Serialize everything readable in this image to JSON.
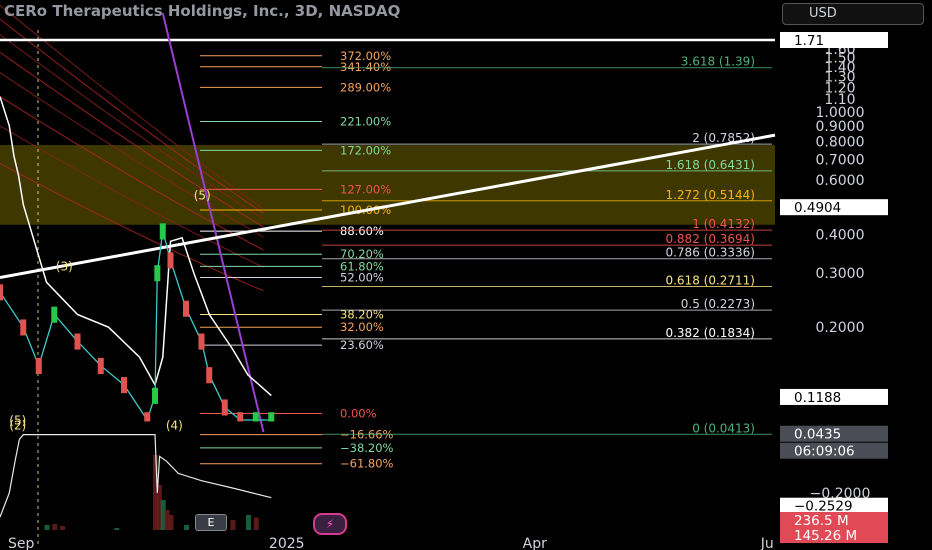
{
  "header": {
    "title": "CERo Therapeutics Holdings, Inc., 3D, NASDAQ",
    "currency": "USD",
    "earnings_badge": "E",
    "flash_icon": "lightning-icon"
  },
  "chart_data": {
    "type": "line",
    "ticker_title": "CERo Therapeutics Holdings, Inc., 3D, NASDAQ",
    "y_scale": "log",
    "ylim": [
      0.0105,
      2.09
    ],
    "y_ticks": [
      {
        "v": 1.6,
        "t": "1.60"
      },
      {
        "v": 1.5,
        "t": "1.50"
      },
      {
        "v": 1.4,
        "t": "1.40"
      },
      {
        "v": 1.3,
        "t": "1.30"
      },
      {
        "v": 1.2,
        "t": "1.20"
      },
      {
        "v": 1.1,
        "t": "1.10"
      },
      {
        "v": 1.0,
        "t": "1.0000"
      },
      {
        "v": 0.9,
        "t": "0.9000"
      },
      {
        "v": 0.8,
        "t": "0.8000"
      },
      {
        "v": 0.7,
        "t": "0.7000"
      },
      {
        "v": 0.6,
        "t": "0.6000"
      },
      {
        "v": 0.4,
        "t": "0.4000"
      },
      {
        "v": 0.3,
        "t": "0.3000"
      },
      {
        "v": 0.2,
        "t": "0.2000"
      },
      {
        "v": -0.2,
        "t": "−0.2000"
      }
    ],
    "price_markers": [
      {
        "v": 1.71,
        "t": "1.71",
        "style": "white"
      },
      {
        "v": 0.4904,
        "t": "0.4904",
        "style": "white"
      },
      {
        "v": 0.1188,
        "t": "0.1188",
        "style": "white"
      },
      {
        "v": 0.0435,
        "t": "0.0435",
        "style": "gray"
      },
      {
        "countdown": "06:09:06",
        "style": "gray"
      },
      {
        "v": -0.2529,
        "t": "−0.2529",
        "style": "white"
      },
      {
        "t": "236.5 M",
        "style": "red"
      },
      {
        "t": "145.26 M",
        "style": "red"
      }
    ],
    "x_labels": [
      {
        "t": "Sep",
        "pos": 0.0
      },
      {
        "t": "2025",
        "pos": 0.37
      },
      {
        "t": "Apr",
        "pos": 0.69
      },
      {
        "t": "Ju",
        "pos": 0.99
      }
    ],
    "fib_extension_levels": [
      {
        "label": "372.00%",
        "v": 1.52,
        "color": "#f7a35c"
      },
      {
        "label": "341.40%",
        "v": 1.4,
        "color": "#f7a35c"
      },
      {
        "label": "289.00%",
        "v": 1.2,
        "color": "#f7a35c"
      },
      {
        "label": "221.00%",
        "v": 0.93,
        "color": "#7fd9a1"
      },
      {
        "label": "172.00%",
        "v": 0.75,
        "color": "#7fd9a1"
      },
      {
        "label": "127.00%",
        "v": 0.56,
        "color": "#f0544f"
      },
      {
        "label": "100.00%",
        "v": 0.48,
        "color": "#f7b500"
      },
      {
        "label": "88.60%",
        "v": 0.41,
        "color": "#ffffff"
      },
      {
        "label": "70.20%",
        "v": 0.345,
        "color": "#7fd9a1"
      },
      {
        "label": "61.80%",
        "v": 0.315,
        "color": "#7fd9a1"
      },
      {
        "label": "52.00%",
        "v": 0.29,
        "color": "#d1d4dc"
      },
      {
        "label": "38.20%",
        "v": 0.22,
        "color": "#f7e27f"
      },
      {
        "label": "32.00%",
        "v": 0.2,
        "color": "#f7a35c"
      },
      {
        "label": "23.60%",
        "v": 0.175,
        "color": "#d1d4dc"
      },
      {
        "label": "0.00%",
        "v": 0.105,
        "color": "#f0544f"
      },
      {
        "label": "−16.66%",
        "v": 0.04,
        "color": "#f7a35c"
      },
      {
        "label": "−38.20%",
        "v": -0.015,
        "color": "#7fd9a1"
      },
      {
        "label": "−61.80%",
        "v": -0.08,
        "color": "#f7a35c"
      }
    ],
    "fib_retracement_levels": [
      {
        "label": "3.618 (1.39)",
        "v": 1.39,
        "color": "#4fb07c"
      },
      {
        "label": "2 (0.7852)",
        "v": 0.7852,
        "color": "#d1d4dc"
      },
      {
        "label": "1.618 (0.6431)",
        "v": 0.6431,
        "color": "#7fd9a1"
      },
      {
        "label": "1.272 (0.5144)",
        "v": 0.5144,
        "color": "#f7b500"
      },
      {
        "label": "1 (0.4132)",
        "v": 0.4132,
        "color": "#f0544f"
      },
      {
        "label": "0.882 (0.3694)",
        "v": 0.3694,
        "color": "#f0544f"
      },
      {
        "label": "0.786 (0.3336)",
        "v": 0.3336,
        "color": "#d1d4dc"
      },
      {
        "label": "0.618 (0.2711)",
        "v": 0.2711,
        "color": "#f7e27f"
      },
      {
        "label": "0.5 (0.2273)",
        "v": 0.2273,
        "color": "#d1d4dc"
      },
      {
        "label": "0.382 (0.1834)",
        "v": 0.1834,
        "color": "#ffffff"
      },
      {
        "label": "0 (0.0413)",
        "v": 0.0413,
        "color": "#4fb07c"
      }
    ],
    "wave_labels": [
      {
        "t": "(5)",
        "x": 0.012,
        "v": 0.082
      },
      {
        "t": "(2)",
        "x": 0.012,
        "v": 0.06
      },
      {
        "t": "(3)",
        "x": 0.072,
        "v": 0.305
      },
      {
        "t": "(5)",
        "x": 0.25,
        "v": 0.52
      },
      {
        "t": "(4)",
        "x": 0.214,
        "v": 0.06
      }
    ],
    "resistance_line": {
      "x": [
        0.0,
        1.0
      ],
      "v": [
        0.29,
        0.84
      ],
      "color": "#ffffff"
    },
    "steep_line": {
      "x": [
        0.21,
        0.34
      ],
      "v": [
        2.09,
        0.05
      ],
      "color": "#9b3fd1"
    },
    "horizontal_line_top": {
      "v": 1.71,
      "color": "#ffffff"
    },
    "highlight_zone": {
      "v_low": 0.43,
      "v_high": 0.78,
      "color": "#8a7a00"
    },
    "white_line": {
      "x": [
        0.0,
        0.012,
        0.018,
        0.024,
        0.03,
        0.06,
        0.1,
        0.14,
        0.18,
        0.2,
        0.21,
        0.22,
        0.235,
        0.25,
        0.27,
        0.3,
        0.32,
        0.35
      ],
      "v": [
        1.12,
        0.9,
        0.72,
        0.62,
        0.5,
        0.28,
        0.22,
        0.2,
        0.16,
        0.13,
        0.16,
        0.38,
        0.39,
        0.3,
        0.22,
        0.17,
        0.14,
        0.12
      ]
    },
    "price_series": {
      "x": [
        0.0,
        0.03,
        0.05,
        0.07,
        0.1,
        0.13,
        0.16,
        0.19,
        0.2,
        0.203,
        0.21,
        0.22,
        0.24,
        0.26,
        0.27,
        0.29,
        0.31,
        0.33,
        0.35
      ],
      "v": [
        0.26,
        0.2,
        0.15,
        0.22,
        0.18,
        0.15,
        0.13,
        0.1,
        0.12,
        0.3,
        0.41,
        0.33,
        0.23,
        0.18,
        0.14,
        0.11,
        0.1,
        0.1,
        0.1
      ]
    },
    "oscillator_line": {
      "x": [
        0.0,
        0.012,
        0.02,
        0.025,
        0.03,
        0.2,
        0.203,
        0.206,
        0.215,
        0.23,
        0.26,
        0.3,
        0.35
      ],
      "v": [
        -0.3,
        -0.2,
        -0.06,
        0.02,
        0.04,
        0.04,
        -0.2,
        -0.05,
        -0.07,
        -0.12,
        -0.15,
        -0.18,
        -0.22
      ]
    },
    "volume_bars": {
      "x": [
        0.06,
        0.07,
        0.08,
        0.15,
        0.2,
        0.205,
        0.21,
        0.215,
        0.22,
        0.24,
        0.27,
        0.3,
        0.32,
        0.33
      ],
      "volume_m": [
        10,
        12,
        8,
        4,
        150,
        90,
        60,
        40,
        30,
        10,
        15,
        20,
        30,
        25
      ]
    },
    "grid": false,
    "legend": "none"
  }
}
